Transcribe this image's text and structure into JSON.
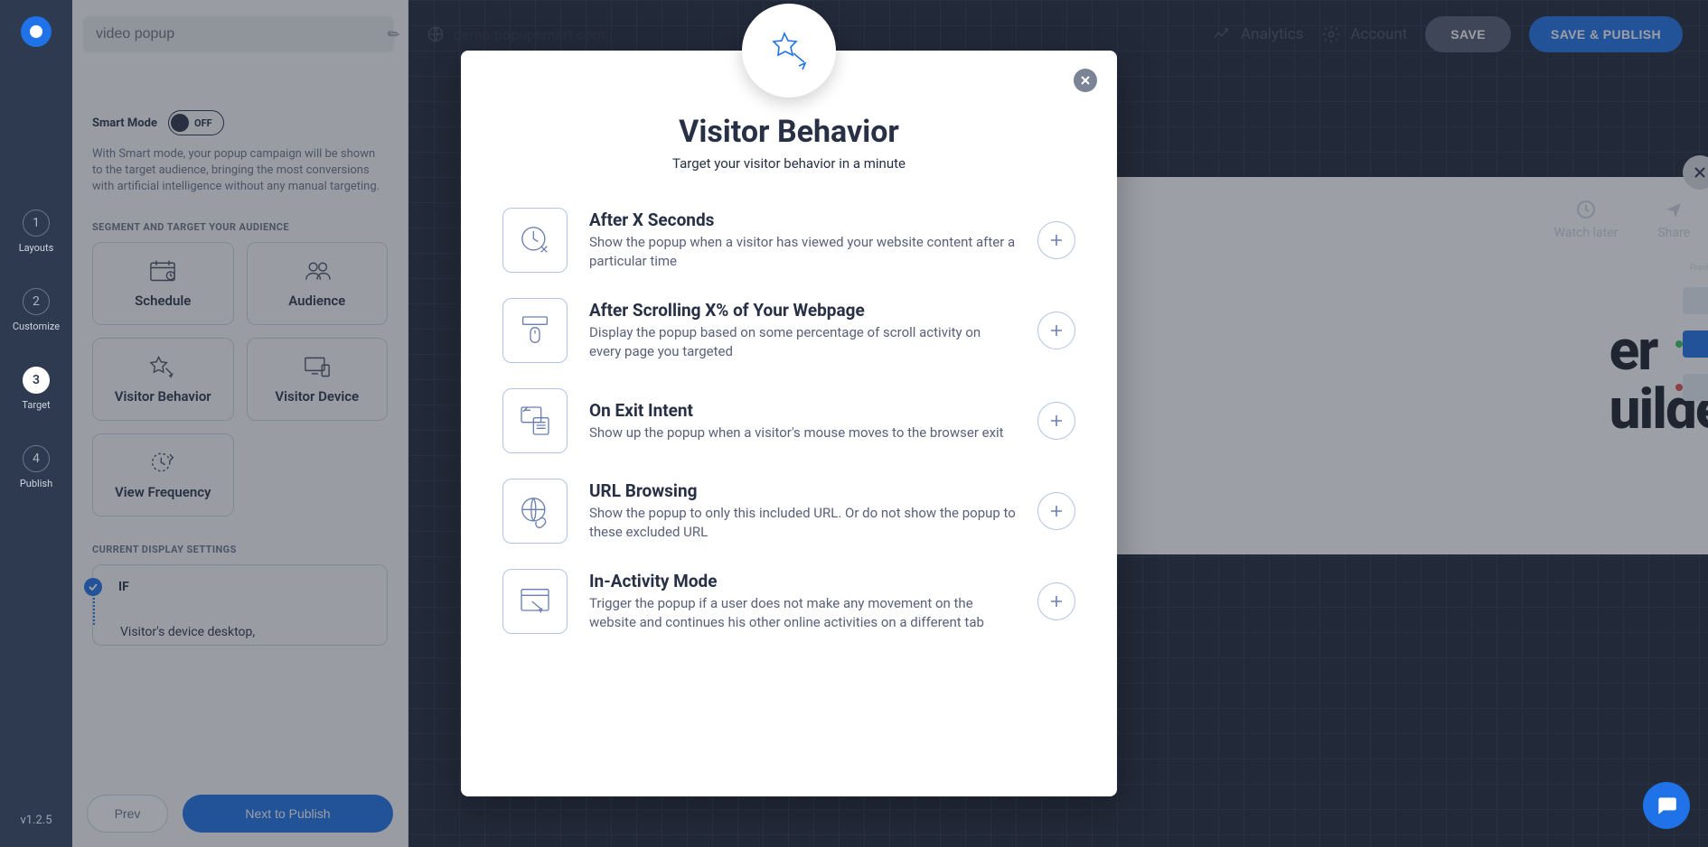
{
  "rail": {
    "steps": [
      {
        "num": "1",
        "label": "Layouts"
      },
      {
        "num": "2",
        "label": "Customize"
      },
      {
        "num": "3",
        "label": "Target"
      },
      {
        "num": "4",
        "label": "Publish"
      }
    ],
    "version": "v1.2.5"
  },
  "topbar": {
    "popup_name": "video popup",
    "site": "demo.popupsmart.com",
    "analytics": "Analytics",
    "account": "Account",
    "save": "SAVE",
    "publish": "SAVE & PUBLISH"
  },
  "panel": {
    "smart_title": "Smart Mode",
    "smart_state": "OFF",
    "smart_desc": "With Smart mode, your popup campaign will be shown to the target audience, bringing the most conversions with artificial intelligence without any manual targeting.",
    "segment_head": "SEGMENT AND TARGET YOUR AUDIENCE",
    "tiles": {
      "schedule": "Schedule",
      "audience": "Audience",
      "behavior": "Visitor Behavior",
      "device": "Visitor Device",
      "frequency": "View Frequency"
    },
    "ds_head": "CURRENT DISPLAY SETTINGS",
    "ds_if": "IF",
    "ds_item1": "Visitor's device desktop,",
    "prev": "Prev",
    "next": "Next to Publish"
  },
  "preview": {
    "watch_later": "Watch later",
    "share": "Share",
    "line1": "er",
    "line2": "uilder."
  },
  "rs_label": "Previ",
  "modal": {
    "title": "Visitor Behavior",
    "subtitle": "Target your visitor behavior in a minute",
    "options": [
      {
        "title": "After X Seconds",
        "desc": "Show the popup when a visitor has viewed your website content after a particular time"
      },
      {
        "title": "After Scrolling X% of Your Webpage",
        "desc": "Display the popup based on some percentage of scroll activity on every page you targeted"
      },
      {
        "title": "On Exit Intent",
        "desc": "Show up the popup when a visitor's mouse moves to the browser exit"
      },
      {
        "title": "URL Browsing",
        "desc": "Show the popup to only this included URL. Or do not show the popup to these excluded URL"
      },
      {
        "title": "In-Activity Mode",
        "desc": "Trigger the popup if a user does not make any movement on the website and continues his other online activities on a different tab"
      }
    ]
  }
}
